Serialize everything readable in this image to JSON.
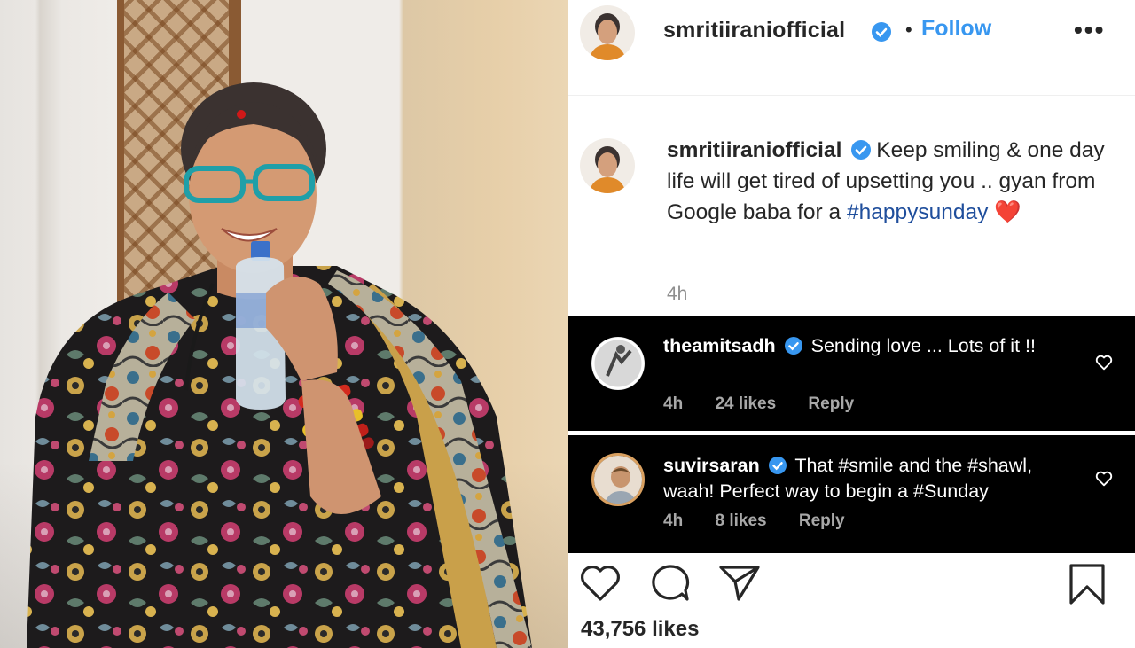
{
  "post": {
    "author": "smritiiraniofficial",
    "follow_label": "Follow",
    "separator": "•",
    "more_label": "•••",
    "caption": {
      "username": "smritiiraniofficial",
      "text_before": "Keep smiling & one day life will get tired of upsetting you .. gyan from Google baba for a ",
      "hashtag": "#happysunday",
      "emoji": "❤️",
      "timestamp": "4h"
    },
    "comments": [
      {
        "username": "theamitsadh",
        "text": "Sending love ... Lots of it !!",
        "time": "4h",
        "likes": "24 likes",
        "reply": "Reply"
      },
      {
        "username": "suvirsaran",
        "text": "That #smile and the #shawl, waah! Perfect way to begin a #Sunday",
        "time": "4h",
        "likes": "8 likes",
        "reply": "Reply"
      }
    ],
    "likes_count": "43,756 likes",
    "icons": {
      "like": "heart-outline-icon",
      "comment": "comment-bubble-icon",
      "share": "paper-plane-icon",
      "save": "bookmark-icon",
      "verified": "verified-badge-icon",
      "comment_like": "small-heart-icon"
    },
    "colors": {
      "link_blue": "#3897f0",
      "hashtag_blue": "#1f4e9c",
      "heart_red": "#e0252f",
      "comment_bg": "#000000"
    }
  }
}
